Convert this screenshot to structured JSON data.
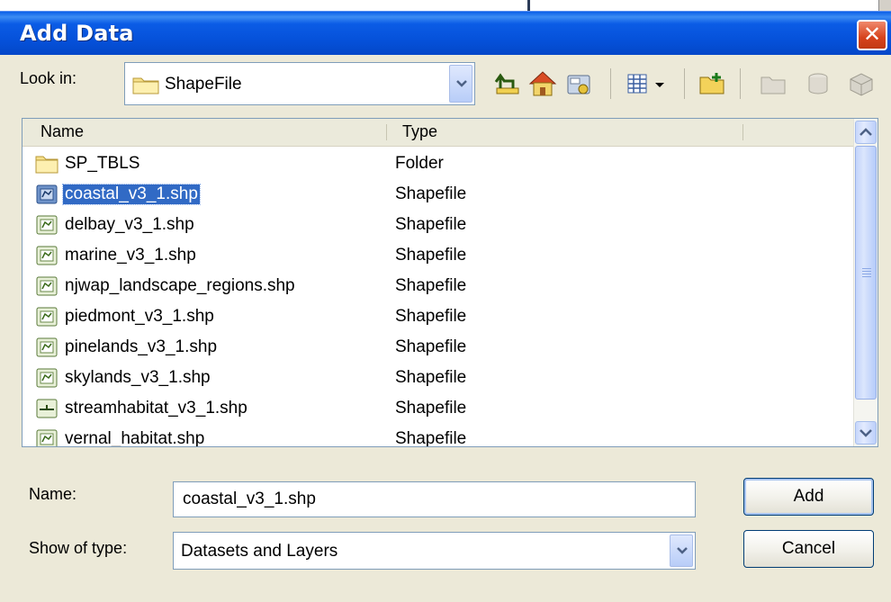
{
  "window": {
    "title": "Add Data",
    "close_glyph": "✕"
  },
  "look_in": {
    "label": "Look in:",
    "value": "ShapeFile"
  },
  "toolbar": {
    "icons": [
      "up-one-level-icon",
      "home-icon",
      "connect-folder-icon",
      "view-options-icon",
      "new-folder-icon",
      "disabled-folder-icon",
      "disabled-database-icon",
      "disabled-table-icon"
    ]
  },
  "file_list": {
    "columns": [
      "Name",
      "Type"
    ],
    "rows": [
      {
        "name": "SP_TBLS",
        "type": "Folder",
        "icon": "folder-icon",
        "selected": false
      },
      {
        "name": "coastal_v3_1.shp",
        "type": "Shapefile",
        "icon": "polygon-shapefile-icon",
        "selected": true
      },
      {
        "name": "delbay_v3_1.shp",
        "type": "Shapefile",
        "icon": "polygon-shapefile-icon",
        "selected": false
      },
      {
        "name": "marine_v3_1.shp",
        "type": "Shapefile",
        "icon": "polygon-shapefile-icon",
        "selected": false
      },
      {
        "name": "njwap_landscape_regions.shp",
        "type": "Shapefile",
        "icon": "polygon-shapefile-icon",
        "selected": false
      },
      {
        "name": "piedmont_v3_1.shp",
        "type": "Shapefile",
        "icon": "polygon-shapefile-icon",
        "selected": false
      },
      {
        "name": "pinelands_v3_1.shp",
        "type": "Shapefile",
        "icon": "polygon-shapefile-icon",
        "selected": false
      },
      {
        "name": "skylands_v3_1.shp",
        "type": "Shapefile",
        "icon": "polygon-shapefile-icon",
        "selected": false
      },
      {
        "name": "streamhabitat_v3_1.shp",
        "type": "Shapefile",
        "icon": "line-shapefile-icon",
        "selected": false
      },
      {
        "name": "vernal_habitat.shp",
        "type": "Shapefile",
        "icon": "polygon-shapefile-icon",
        "selected": false
      }
    ]
  },
  "name_field": {
    "label": "Name:",
    "value": "coastal_v3_1.shp"
  },
  "type_field": {
    "label": "Show of type:",
    "value": "Datasets and Layers"
  },
  "buttons": {
    "add": "Add",
    "cancel": "Cancel"
  },
  "colors": {
    "title_bar": "#0550d8",
    "selection": "#316ac5",
    "dialog_bg": "#ece9d8"
  }
}
